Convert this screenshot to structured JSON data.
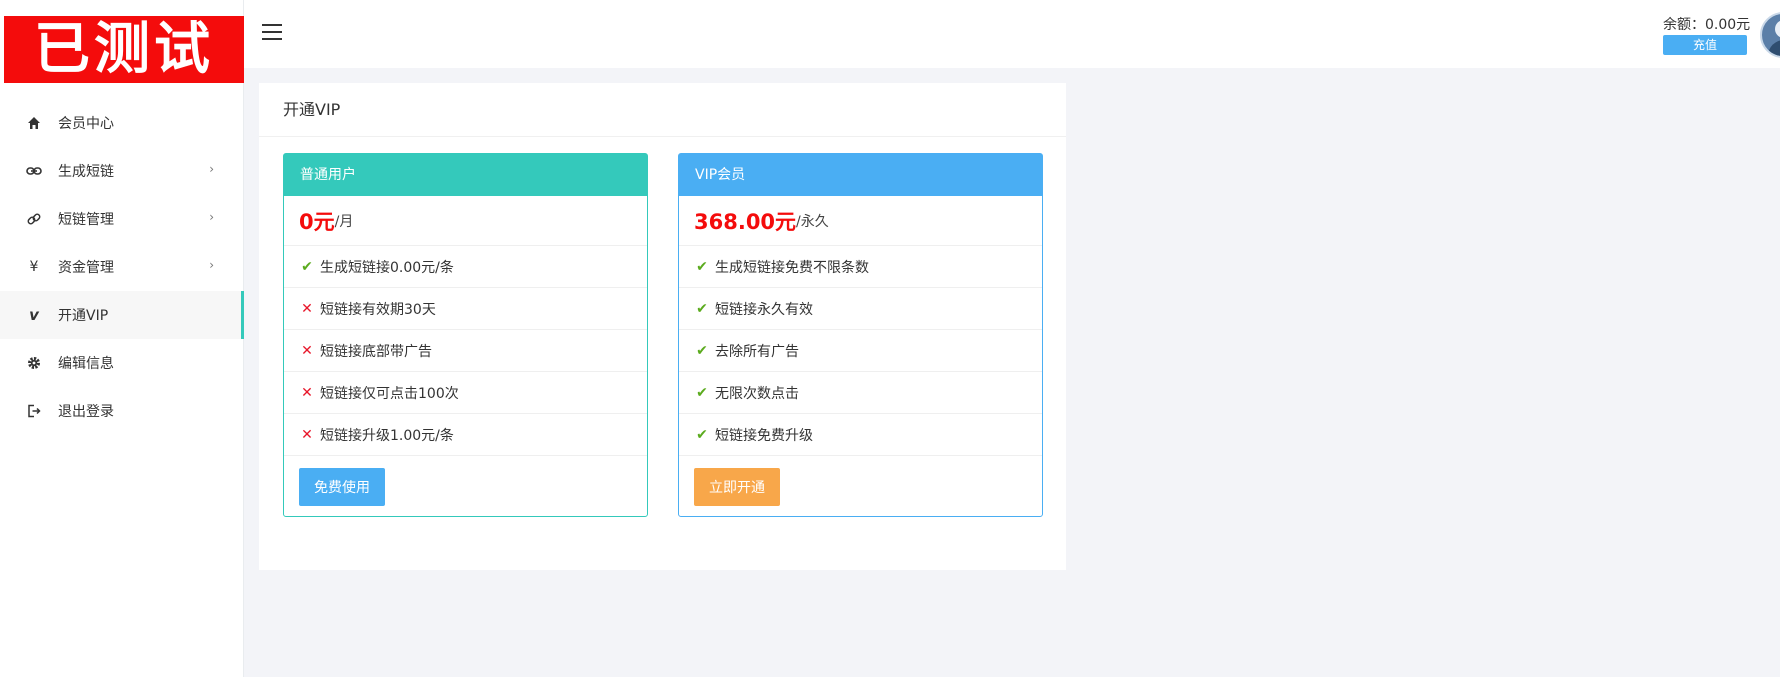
{
  "logo": {
    "text": "已测试"
  },
  "sidebar": {
    "items": [
      {
        "label": "会员中心",
        "icon": "home-icon",
        "has_submenu": false,
        "active": false
      },
      {
        "label": "生成短链",
        "icon": "link-icon",
        "has_submenu": true,
        "active": false
      },
      {
        "label": "短链管理",
        "icon": "chain-icon",
        "has_submenu": true,
        "active": false
      },
      {
        "label": "资金管理",
        "icon": "yen-icon",
        "has_submenu": true,
        "active": false
      },
      {
        "label": "开通VIP",
        "icon": "vimeo-icon",
        "has_submenu": false,
        "active": true
      },
      {
        "label": "编辑信息",
        "icon": "gear-icon",
        "has_submenu": false,
        "active": false
      },
      {
        "label": "退出登录",
        "icon": "logout-icon",
        "has_submenu": false,
        "active": false
      }
    ]
  },
  "header": {
    "balance_label": "余额：",
    "balance_value": "0.00元",
    "recharge_label": "充值"
  },
  "main": {
    "title": "开通VIP",
    "plans": [
      {
        "name": "普通用户",
        "price": "0元",
        "period": "/月",
        "features": [
          {
            "text": "生成短链接0.00元/条",
            "ok": true
          },
          {
            "text": "短链接有效期30天",
            "ok": false
          },
          {
            "text": "短链接底部带广告",
            "ok": false
          },
          {
            "text": "短链接仅可点击100次",
            "ok": false
          },
          {
            "text": "短链接升级1.00元/条",
            "ok": false
          }
        ],
        "button_label": "免费使用"
      },
      {
        "name": "VIP会员",
        "price": "368.00元",
        "period": "/永久",
        "features": [
          {
            "text": "生成短链接免费不限条数",
            "ok": true
          },
          {
            "text": "短链接永久有效",
            "ok": true
          },
          {
            "text": "去除所有广告",
            "ok": true
          },
          {
            "text": "无限次数点击",
            "ok": true
          },
          {
            "text": "短链接免费升级",
            "ok": true
          }
        ],
        "button_label": "立即开通"
      }
    ]
  },
  "colors": {
    "accent_teal": "#34c9bb",
    "accent_blue": "#4aaef3",
    "accent_orange": "#f8a74a",
    "price_red": "#f40c0c",
    "logo_red": "#f40c0c"
  }
}
